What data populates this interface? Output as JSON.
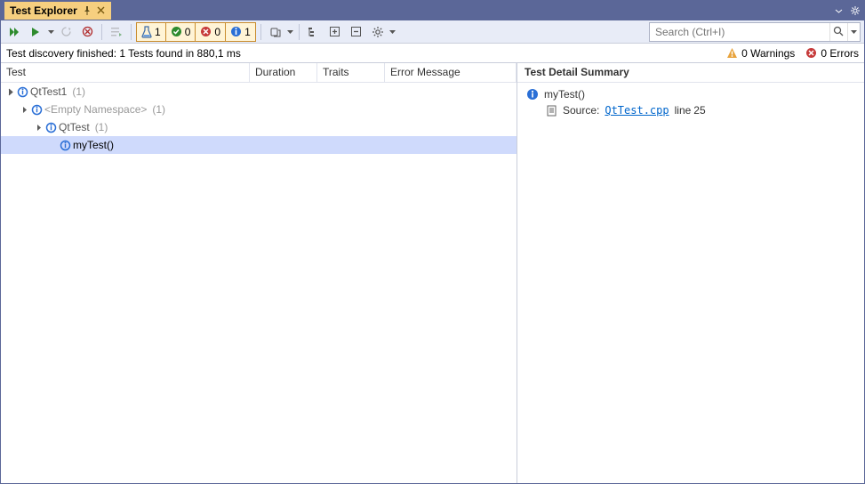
{
  "titlebar": {
    "tab_label": "Test Explorer"
  },
  "toolbar": {
    "filters": {
      "total": "1",
      "passed": "0",
      "failed": "0",
      "notrun": "1"
    }
  },
  "search": {
    "placeholder": "Search (Ctrl+I)"
  },
  "status": {
    "message": "Test discovery finished: 1 Tests found in 880,1 ms",
    "warnings": "0 Warnings",
    "errors": "0 Errors"
  },
  "columns": {
    "test": "Test",
    "duration": "Duration",
    "traits": "Traits",
    "error": "Error Message"
  },
  "tree": {
    "root": {
      "name": "QtTest1",
      "count": "(1)"
    },
    "ns": {
      "name": "<Empty Namespace>",
      "count": "(1)"
    },
    "class": {
      "name": "QtTest",
      "count": "(1)"
    },
    "test": {
      "name": "myTest()"
    }
  },
  "detail": {
    "header": "Test Detail Summary",
    "test_name": "myTest()",
    "source_label": "Source:",
    "source_file": "QtTest.cpp",
    "source_line_prefix": "line",
    "source_line": "25"
  }
}
